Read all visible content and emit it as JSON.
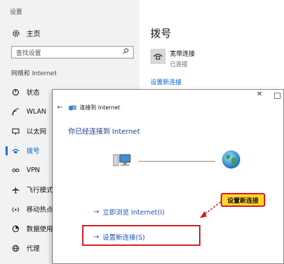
{
  "settings": {
    "window_title": "设置",
    "home_label": "主页",
    "search_placeholder": "查找设置",
    "section_title": "网络和 Internet",
    "nav_items": [
      {
        "label": "状态",
        "icon": "status-icon"
      },
      {
        "label": "WLAN",
        "icon": "wifi-icon"
      },
      {
        "label": "以太网",
        "icon": "ethernet-icon"
      },
      {
        "label": "拨号",
        "icon": "dialup-icon",
        "active": true
      },
      {
        "label": "VPN",
        "icon": "vpn-icon"
      },
      {
        "label": "飞行模式",
        "icon": "airplane-icon"
      },
      {
        "label": "移动热点",
        "icon": "hotspot-icon"
      },
      {
        "label": "数据使用量",
        "icon": "data-usage-icon"
      },
      {
        "label": "代理",
        "icon": "globe-icon"
      }
    ],
    "page_title": "拨号",
    "connection": {
      "name": "宽带连接",
      "status": "已连接"
    },
    "setup_link": "设置新连接"
  },
  "dialog": {
    "title": "连接到 Internet",
    "heading": "你已经连接到 Internet",
    "browse_link": "立即浏览 Internet(I)",
    "setup_link": "设置新连接(S)"
  },
  "callout": {
    "text": "设置新连接"
  },
  "colors": {
    "accent": "#0078d7",
    "link": "#1a55b5",
    "highlight": "#d42020",
    "callout_bg": "#ffd52a"
  }
}
